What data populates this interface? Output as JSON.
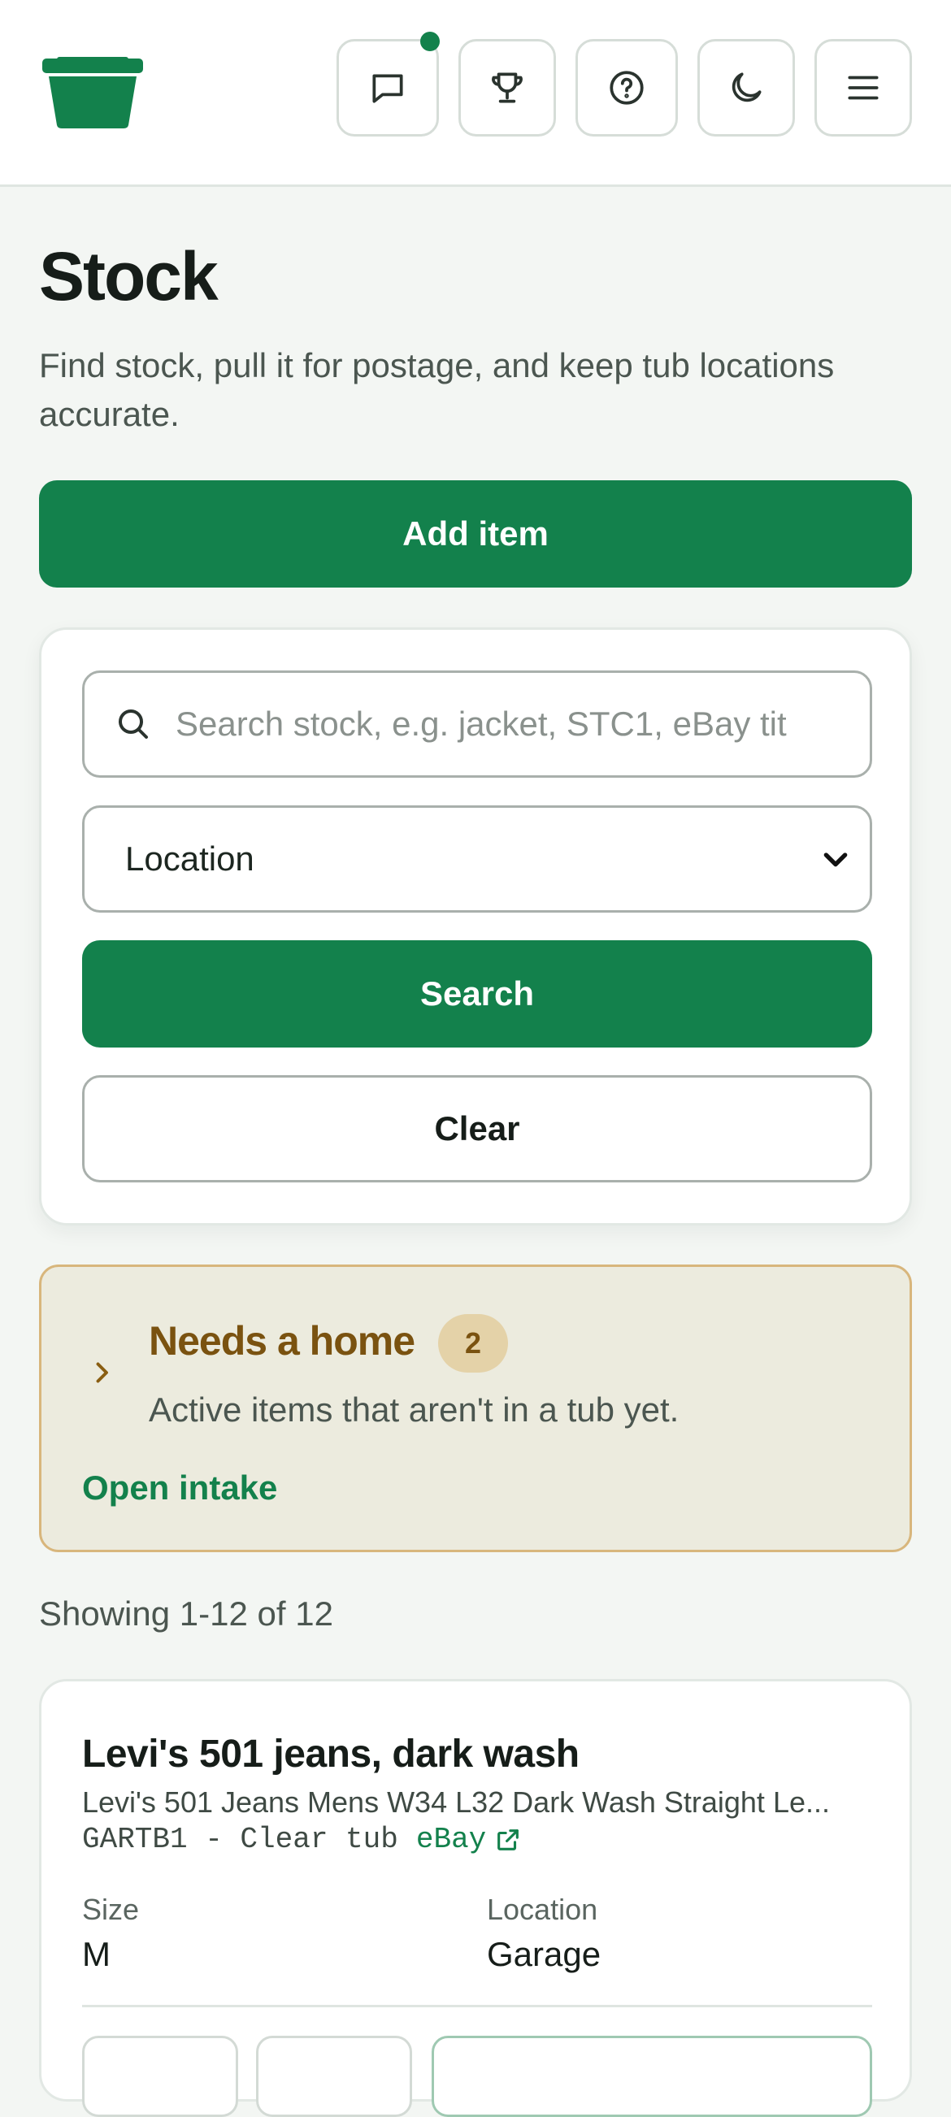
{
  "header": {
    "logo_icon": "tub-icon",
    "brand_color": "#13814c",
    "buttons": [
      {
        "name": "messages",
        "icon": "chat-bubble-icon",
        "has_notification": true
      },
      {
        "name": "achievements",
        "icon": "trophy-icon"
      },
      {
        "name": "help",
        "icon": "question-circle-icon"
      },
      {
        "name": "theme",
        "icon": "moon-icon"
      },
      {
        "name": "menu",
        "icon": "hamburger-menu-icon"
      }
    ]
  },
  "page": {
    "title": "Stock",
    "subtitle": "Find stock, pull it for postage, and keep tub locations accurate.",
    "add_item_label": "Add item"
  },
  "search": {
    "placeholder": "Search stock, e.g. jacket, STC1, eBay tit",
    "value": "",
    "location_selected": "Location",
    "search_label": "Search",
    "clear_label": "Clear"
  },
  "needs_home": {
    "title": "Needs a home",
    "count": "2",
    "description": "Active items that aren't in a tub yet.",
    "link_label": "Open intake"
  },
  "results": {
    "summary": "Showing 1-12 of 12",
    "items": [
      {
        "name": "Levi's 501 jeans, dark wash",
        "listing_title": "Levi's 501 Jeans Mens W34 L32 Dark Wash Straight Le...",
        "location_code": "GARTB1 - Clear tub",
        "ebay_label": "eBay",
        "size_label": "Size",
        "size_value": "M",
        "location_label": "Location",
        "location_value": "Garage"
      }
    ]
  }
}
